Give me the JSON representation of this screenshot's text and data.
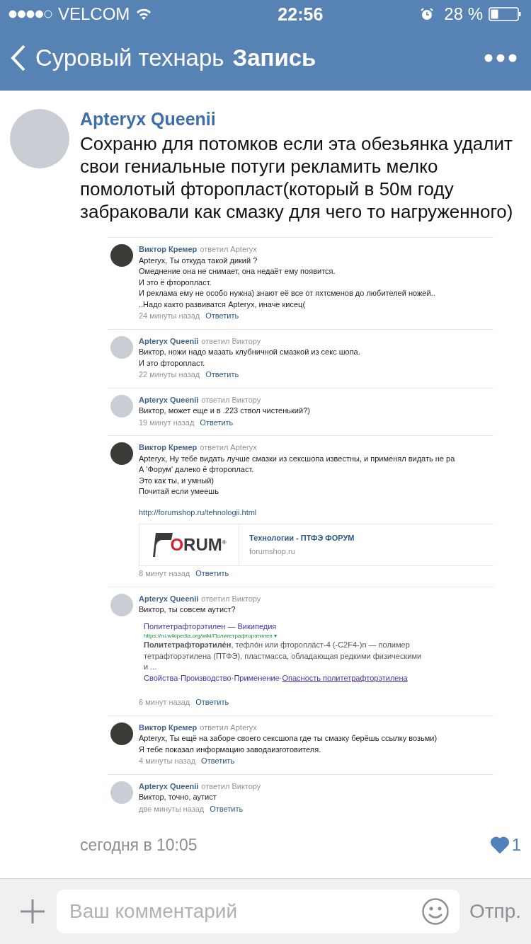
{
  "status_bar": {
    "carrier": "VELCOM",
    "time": "22:56",
    "battery": "28 %"
  },
  "nav": {
    "back_label": "Суровый технарь",
    "title": "Запись"
  },
  "post": {
    "author": "Apteryx Queenii",
    "color": "#c9ced4",
    "text": "Сохраню для потомков если эта обезьянка удалит свои гениальные потуги рекламить мелко помолотый фторопласт(который в 50м году забраковали как смазку для чего то нагруженного)",
    "date": "сегодня в 10:05",
    "likes": "1",
    "liked": true
  },
  "screenshot": {
    "comments": [
      {
        "author": "Виктор Кремер",
        "action": "ответил Apteryx",
        "color": "#3a3a36",
        "lines": [
          "Apteryx, Ты откуда такой дикий ?",
          "Омеднение она не снимает, она недаёт ему появится.",
          "И это ё фторопласт.",
          "И реклама ему не особо нужна) знают её все от яхтсменов до любителей ножей..",
          "..Надо както развиватся Apteryx, иначе кисец("
        ],
        "time": "24 минуты назад",
        "reply": "Ответить"
      },
      {
        "author": "Apteryx Queenii",
        "action": "ответил Виктору",
        "color": "#c9ced4",
        "lines": [
          "Виктор, ножи надо мазать клубничной смазкой из секс шопа.",
          "И это фторопласт."
        ],
        "time": "22 минуты назад",
        "reply": "Ответить"
      },
      {
        "author": "Apteryx Queenii",
        "action": "ответил Виктору",
        "color": "#c9ced4",
        "lines": [
          "Виктор, может еще и в .223 ствол чистенький?)"
        ],
        "time": "19 минут назад",
        "reply": "Ответить"
      },
      {
        "author": "Виктор Кремер",
        "action": "ответил Apteryx",
        "color": "#3a3a36",
        "lines": [
          "Apteryx, Ну тебе видать лучше смазки из сексшопа известны, и применял видать не ра",
          "А 'Форум' далеко ё фторопласт.",
          "Это как ты, и умный)",
          "Почитай если умеешь"
        ],
        "attachments": [
          {
            "kind": "link",
            "url": "http://forumshop.ru/tehnologii.html"
          },
          {
            "kind": "card",
            "logo_text": "ORUM",
            "logo_mark": "®",
            "title": "Технологии - ПТФЭ ФОРУМ",
            "domain": "forumshop.ru"
          }
        ],
        "time": "8 минут назад",
        "reply": "Ответить"
      },
      {
        "author": "Apteryx Queenii",
        "action": "ответил Виктору",
        "color": "#c9ced4",
        "lines": [
          "Виктор, ты совсем аутист?"
        ],
        "attachments": [
          {
            "kind": "search_result",
            "title": "Политетрафторэтилен — Википедия",
            "url": "https://ru.wikipedia.org/wiki/Политетрафторэтилен",
            "url_caret": "▾",
            "snippet": "**Политетрафторэтиле́н**, тефло́н или фторопла́ст-4 (-C2F4-)n — полимер тетрафторэтилена (ПТФЭ), пластмасса, обладающая редкими физическими и ...",
            "separator": "·",
            "links": [
              {
                "label": "Свойства",
                "underlined": false
              },
              {
                "label": "Производство",
                "underlined": false
              },
              {
                "label": "Применение",
                "underlined": false
              },
              {
                "label": "Опасность политетрафторэтилена",
                "underlined": true
              }
            ]
          }
        ],
        "time": "6 минут назад",
        "reply": "Ответить"
      },
      {
        "author": "Виктор Кремер",
        "action": "ответил Apteryx",
        "color": "#3a3a36",
        "lines": [
          "Apteryx, Ты ещё на заборе своего сексшопа где ты смазку берёшь ссылку возьми)",
          "Я тебе показал информацию заводаизготовителя."
        ],
        "time": "4 минуты назад",
        "reply": "Ответить"
      },
      {
        "author": "Apteryx Queenii",
        "action": "ответил Виктору",
        "color": "#c9ced4",
        "lines": [
          "Виктор, точно, аутист"
        ],
        "time": "две минуты назад",
        "reply": "Ответить"
      }
    ]
  },
  "composer": {
    "placeholder": "Ваш комментарий",
    "send": "Отпр.",
    "send_disabled": true
  }
}
